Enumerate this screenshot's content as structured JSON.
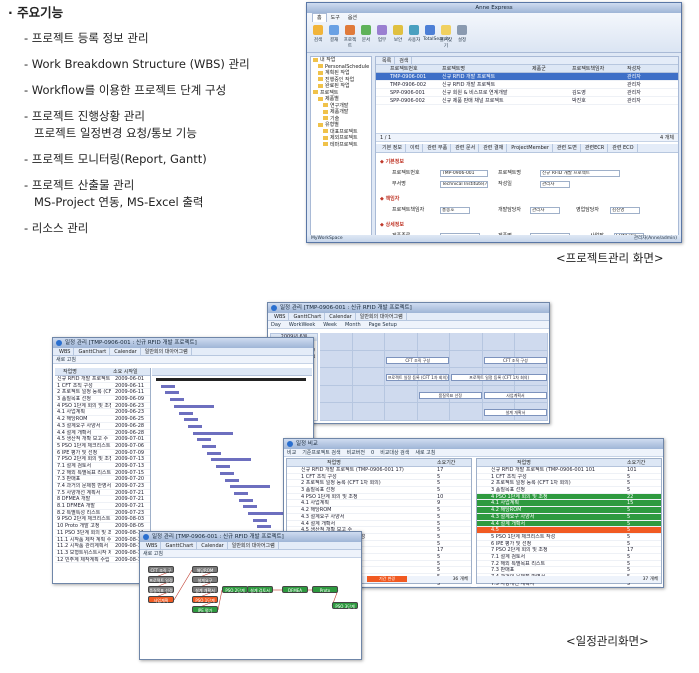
{
  "features": {
    "heading": "· 주요기능",
    "items": [
      {
        "line1": "- 프로젝트 등록 정보 관리",
        "line2": ""
      },
      {
        "line1": "- Work Breakdown Structure (WBS) 관리",
        "line2": ""
      },
      {
        "line1": "- Workflow를 이용한 프로젝트 단계 구성",
        "line2": ""
      },
      {
        "line1": "- 프로젝트 진행상황 관리",
        "line2": "프로젝트 일정변경 요청/통보 기능"
      },
      {
        "line1": "- 프로젝트 모니터링(Report, Gantt)",
        "line2": ""
      },
      {
        "line1": "- 프로젝트 산출물 관리",
        "line2": "MS-Project 연동, MS-Excel 출력"
      },
      {
        "line1": "- 리소스 관리",
        "line2": ""
      }
    ]
  },
  "captions": {
    "project_screen": "<프로젝트관리 화면>",
    "schedule_screen": "<일정관리화면>"
  },
  "app": {
    "title": "Anne Express",
    "ribbon_tabs": [
      "홈",
      "도구",
      "옵션"
    ],
    "ribbon_buttons": [
      "검색",
      "결재",
      "프로젝트",
      "문서",
      "업무",
      "보안",
      "사용자",
      "TotalSearch",
      "즐겨찾기",
      "설정"
    ],
    "nav_items": [
      "내 작업",
      "PersonalSchedule",
      "계획된 작업",
      "진행중인 작업",
      "완료된 작업",
      "프로젝트",
      "제품별",
      "연구개발",
      "제품개발",
      "기술",
      "유형별",
      "대표프로젝트",
      "제외프로젝트",
      "테마프로젝트"
    ],
    "pane_tabs": [
      "목록",
      "검색"
    ],
    "grid_header": [
      "프로젝트번호",
      "프로젝트명",
      "제품군",
      "프로젝트책임자",
      "작성자"
    ],
    "grid_rows": [
      [
        "TMP-0906-001",
        "신규 RFID 개발 프로젝트",
        "",
        "",
        "관리자"
      ],
      [
        "TMP-0906-002",
        "신규 RFID 개발 프로젝트",
        "",
        "",
        "관리자"
      ],
      [
        "SPP-0906-001",
        "신규 회원 & 비스프로 연계개발",
        "",
        "김도영",
        "관리자"
      ],
      [
        "SPP-0906-002",
        "신규 제품 판매 채널 프로젝트",
        "",
        "박진호",
        "관리자"
      ]
    ],
    "pager": "1 / 1",
    "count": "4 개체",
    "detail_tabs": [
      "기본 정보",
      "이력",
      "관련 부품",
      "관련 문서",
      "관련 결재",
      "ProjectMember",
      "관련 도면",
      "관련ECR",
      "관련 ECO"
    ],
    "section_basic": "◆ 기본정보",
    "fields": {
      "project_no_label": "프로젝트번호",
      "project_no": "TMP-0906-001",
      "project_name_label": "프로젝트명",
      "project_name": "신규 RFID 개발 프로젝트",
      "dept_label": "부서명",
      "dept": "Technical Institute(기",
      "author_label": "작성일",
      "author": "관리자"
    },
    "section_owner": "◆ 책임자",
    "owner_fields": {
      "pm_label": "프로젝트책임자",
      "pm": "홍종호",
      "dev_label": "개발담당자",
      "dev": "관리자",
      "sales_label": "영업담당자",
      "sales": "김진영"
    },
    "section_product": "◆ 상세정보",
    "product_fields": {
      "product_label": "제품종류",
      "customer_label": "제품명",
      "maker_label": "사업장",
      "maker": "SONGRU"
    },
    "status_left": "MyWorkSpace",
    "status_right": "관리자(Anne/admin)"
  },
  "schedule": {
    "cal_title": "일정 관리 [TMP-0906-001 : 신규 RFID 개발 프로젝트]",
    "cal_tabs": [
      "WBS",
      "GanttChart",
      "Calendar",
      "일반회의 대아어그램"
    ],
    "cal_tools": [
      "Day",
      "WorkWeek",
      "Week",
      "Month",
      "Page Setup"
    ],
    "cal_month": "2009년 6월",
    "cal_events": [
      "CFT 조직 구성",
      "CFT 조직 구성",
      "프로젝트 일정 등록 (CFT 1차 회의)",
      "프로젝트 일정 등록 (CFT 1차 회의)",
      "품질목표 선정",
      "사업계획서",
      "설계 개확서"
    ],
    "gantt_title": "일정 관리 [TMP-0906-001 : 신규 RFID 개발 프로젝트]",
    "gantt_tabs": [
      "WBS",
      "GanttChart",
      "Calendar",
      "일반회의 대아어그램"
    ],
    "gantt_tool": "새로 고침",
    "gantt_cols": [
      "작업명",
      "소요 시작일"
    ],
    "gantt_rows": [
      [
        "신규 RFID 개발 프로젝트",
        "2009-06-01"
      ],
      [
        "1 CFT 조직 구성",
        "2009-06-11"
      ],
      [
        "2 프로젝트 일정 등록 (CFT",
        "2009-06-11"
      ],
      [
        "3 품질목표 선정",
        "2009-06-09"
      ],
      [
        "4 PSO 1단계 회의 및 조정",
        "2009-06-23"
      ],
      [
        "4.1 사업계획",
        "2009-06-23"
      ],
      [
        "4.2 해당ROM",
        "2009-06-25"
      ],
      [
        "4.3 설계요구 사양서",
        "2009-06-28"
      ],
      [
        "4.4 설계 개확서",
        "2009-06-28"
      ],
      [
        "4.5 생산적 개확 보고 수",
        "2009-07-01"
      ],
      [
        "5 PSO 1단계 체크리스트 작",
        "2009-07-06"
      ],
      [
        "6 IPE 평가 및 선정",
        "2009-07-09"
      ],
      [
        "7 PSO 2단계 회의 및 조정",
        "2009-07-13"
      ],
      [
        "7.1 설계 검토서",
        "2009-07-13"
      ],
      [
        "7.2 해외 특별목표 리스트",
        "2009-07-15"
      ],
      [
        "7.3 판매표",
        "2009-07-20"
      ],
      [
        "7.4 과거의 문제점 반영서",
        "2009-07-23"
      ],
      [
        "7.5 사양개선 계획서",
        "2009-07-21"
      ],
      [
        "8 DFMEA 개발",
        "2009-07-21"
      ],
      [
        "8.1 DFMEA 개발",
        "2009-07-21"
      ],
      [
        "8.2 특별특성 리스트",
        "2009-07-23"
      ],
      [
        "9 PSO 2단계 체크리스트 작",
        "2009-08-03"
      ],
      [
        "10 Proto 개발 고정",
        "2009-08-05"
      ],
      [
        "11 PSO 3단계 회의 및 조정",
        "2009-08-11"
      ],
      [
        "11.1 시작품 제작 계획 수",
        "2009-08-13"
      ],
      [
        "11.2 시작품 관리계획서",
        "2009-08-13"
      ],
      [
        "11.3 모형트위스트시작 제",
        "2009-08-17"
      ],
      [
        "12 민주계 제작계획 수립",
        "2009-08-18"
      ]
    ],
    "compare_title": "일정 비교",
    "compare_tools": [
      "비교",
      "기준프로젝트 검색",
      "비교버전",
      "0",
      "비교대상 검색",
      "새로 고침"
    ],
    "compare_cols": [
      "작업명",
      "소요기간"
    ],
    "compare_left": [
      [
        "신규 RFID 개발 프로젝트 (TMP-0906-001 17)",
        "17"
      ],
      [
        "1 CFT 조직 구성",
        "5"
      ],
      [
        "2 프로젝트 일정 등록 (CFT 1차 회의)",
        "5"
      ],
      [
        "3 품질목표 선정",
        "5"
      ],
      [
        "4 PSO 1단계 회의 및 조정",
        "10"
      ],
      [
        "4.1 사업계획",
        "9"
      ],
      [
        "4.2 해당ROM",
        "5"
      ],
      [
        "4.3 설계요구 사양서",
        "5"
      ],
      [
        "4.4 설계 개확서",
        "5"
      ],
      [
        "4.5 생산적 개확 보고 수",
        "5"
      ],
      [
        "5 PSO 1단계 체크리스트 작성",
        "5"
      ],
      [
        "6 IPE 평가 및 선정",
        "5"
      ],
      [
        "7 PSO 2단계 회의 및 조정",
        "17"
      ],
      [
        "7.1 설계 검토서",
        "5"
      ],
      [
        "7.2 해외 특별목표 리스트",
        "5"
      ],
      [
        "7.3 판매표",
        "5"
      ],
      [
        "7.4 과거의 문제점 반영서",
        "5"
      ],
      [
        "7.5 사양개선 계획서",
        "5"
      ],
      [
        "8 DFMEA 개발",
        "5"
      ],
      [
        "8.1 DFMEA 개발",
        "5"
      ],
      [
        "8.2 특별특성 리스트",
        "5"
      ],
      [
        "9 PSO 2단계 체크리스트 작성",
        "5"
      ],
      [
        "10 Proto 개발 고정",
        "4"
      ],
      [
        "11 PSO 3단계 회의 및 조정",
        "15"
      ]
    ],
    "compare_right": [
      [
        "신규 RFID 개발 프로젝트 (TMP-0906-001 101",
        "101"
      ],
      [
        "1 CFT 조직 구성",
        "5"
      ],
      [
        "2 프로젝트 일정 등록 (CFT 1차 회의)",
        "5"
      ],
      [
        "3 품질목표 선정",
        "5"
      ],
      [
        "4 PSO 1단계 회의 및 조정",
        "22"
      ],
      [
        "4.1 사업계획",
        "15"
      ],
      [
        "4.2 해당ROM",
        "5"
      ],
      [
        "4.3 설계요구 사양서",
        "5"
      ],
      [
        "4.4 설계 개확서",
        "5"
      ],
      [
        "4.5",
        "5"
      ],
      [
        "5 PSO 1단계 체크리스트 작성",
        "5"
      ],
      [
        "6 IPE 평가 및 선정",
        "5"
      ],
      [
        "7 PSO 2단계 회의 및 조정",
        "17"
      ],
      [
        "7.1 설계 검토서",
        "5"
      ],
      [
        "7.2 해외 특별목표 리스트",
        "5"
      ],
      [
        "7.3 판매표",
        "5"
      ],
      [
        "7.4 과거의 문제점 반영서",
        "5"
      ],
      [
        "7.5 사양개선 계획서",
        "5"
      ],
      [
        "8 DFMEA 개발",
        "5"
      ],
      [
        "8.1 DFMEA 개발",
        "5"
      ],
      [
        "8.2 특별특성 리스트",
        "5"
      ],
      [
        "9 PSO 2단계 체크리스트 작성",
        "5"
      ],
      [
        "10 Proto 개발 고정",
        "4"
      ],
      [
        "11 PSO 3단계 회의 및 조정",
        "15"
      ]
    ],
    "compare_count_left": "36 개체",
    "compare_count_right": "37 개체",
    "compare_legend": "기간 변경",
    "flow_title": "일정 관리 [TMP-0906-001 : 신규 RFID 개발 프로젝트]",
    "flow_tabs": [
      "WBS",
      "GanttChart",
      "Calendar",
      "일반회의 대아어그램"
    ],
    "flow_tool": "새로 고침",
    "flow_nodes": [
      "CFT 조직 구성",
      "프로젝트 일정 등록",
      "품질목표 선정",
      "사업계획",
      "해당ROM",
      "설계요구",
      "설계 개확서",
      "PSO 1단계",
      "IPE 평가",
      "PSO 2단계",
      "설계 검토서",
      "DFMEA",
      "Proto",
      "PSO 3단계"
    ]
  }
}
